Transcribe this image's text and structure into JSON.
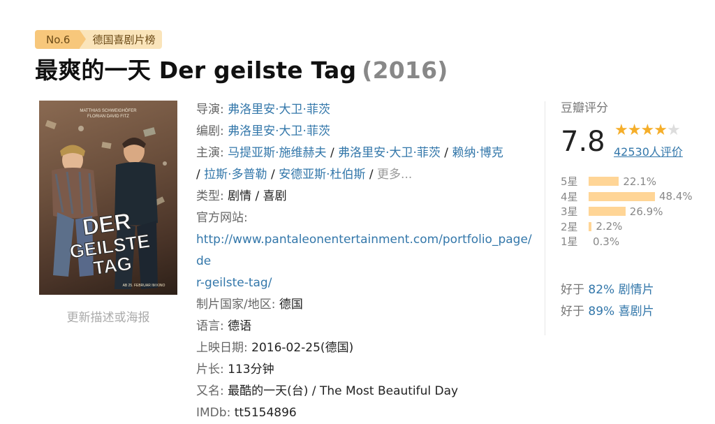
{
  "badge": {
    "rank": "No.6",
    "list_name": "德国喜剧片榜"
  },
  "title": {
    "name": "最爽的一天 Der geilste Tag",
    "year": "(2016)"
  },
  "poster": {
    "credits_line1": "MATTHIAS SCHWEIGHÖFER",
    "credits_line2": "FLORIAN DAVID FITZ",
    "title_lines": [
      "DER",
      "GEILSTE",
      "TAG"
    ],
    "date_text": "AB 25. FEBRUAR IM KINO",
    "update_link": "更新描述或海报"
  },
  "info": {
    "director_label": "导演:",
    "directors": [
      "弗洛里安·大卫·菲茨"
    ],
    "writer_label": "编剧:",
    "writers": [
      "弗洛里安·大卫·菲茨"
    ],
    "cast_label": "主演:",
    "cast_line1": [
      "马提亚斯·施维赫夫",
      "弗洛里安·大卫·菲茨",
      "赖纳·博克"
    ],
    "cast_line2": [
      "拉斯·多普勒",
      "安德亚斯·杜伯斯"
    ],
    "cast_more": "更多...",
    "separator": " / ",
    "genre_label": "类型:",
    "genres": "剧情 / 喜剧",
    "site_label": "官方网站:",
    "site_url_line1": "http://www.pantaleonentertainment.com/portfolio_page/de",
    "site_url_line2": "r-geilste-tag/",
    "country_label": "制片国家/地区:",
    "country": "德国",
    "language_label": "语言:",
    "language": "德语",
    "release_label": "上映日期:",
    "release": "2016-02-25(德国)",
    "runtime_label": "片长:",
    "runtime": "113分钟",
    "aka_label": "又名:",
    "aka": "最酷的一天(台) / The Most Beautiful Day",
    "imdb_label": "IMDb:",
    "imdb": "tt5154896"
  },
  "rating": {
    "title": "豆瓣评分",
    "score": "7.8",
    "stars_filled": 4,
    "stars_total": 5,
    "votes": "42530人评价",
    "distribution": [
      {
        "label": "5星",
        "percent": 22.1,
        "text": "22.1%"
      },
      {
        "label": "4星",
        "percent": 48.4,
        "text": "48.4%"
      },
      {
        "label": "3星",
        "percent": 26.9,
        "text": "26.9%"
      },
      {
        "label": "2星",
        "percent": 2.2,
        "text": "2.2%"
      },
      {
        "label": "1星",
        "percent": 0.3,
        "text": "0.3%"
      }
    ],
    "better_than": [
      {
        "prefix": "好于 ",
        "value": "82% 剧情片"
      },
      {
        "prefix": "好于 ",
        "value": "89% 喜剧片"
      }
    ]
  },
  "colors": {
    "link": "#3377aa",
    "badge": "#f7c77b",
    "bar": "#ffd596",
    "star": "#f5ae2a"
  }
}
